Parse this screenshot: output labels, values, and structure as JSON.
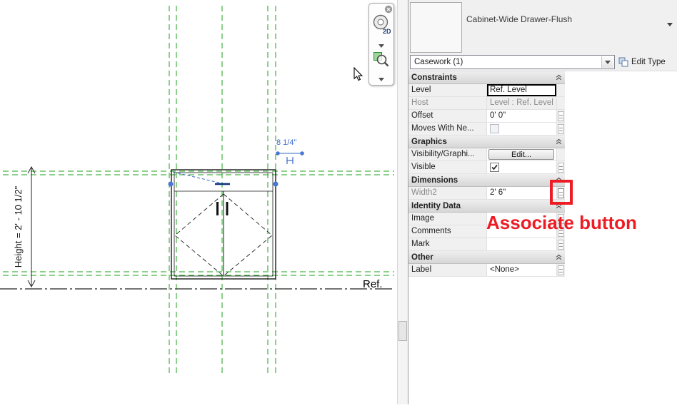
{
  "canvas": {
    "dimension_label": "8 1/4\"",
    "height_label": "Height = 2' - 10 1/2\"",
    "ref_label": "Ref.",
    "navbar_2d": "2D",
    "colors": {
      "reference_plane_green": "#18a018",
      "control_blue": "#3668c8"
    }
  },
  "palette": {
    "type_name": "Cabinet-Wide Drawer-Flush",
    "selector_value": "Casework (1)",
    "edit_type_label": "Edit Type",
    "section_titles": {
      "constraints": "Constraints",
      "graphics": "Graphics",
      "dimensions": "Dimensions",
      "identity": "Identity Data",
      "other": "Other"
    },
    "rows": {
      "level": {
        "label": "Level",
        "value": "Ref. Level"
      },
      "host": {
        "label": "Host",
        "value": "Level : Ref. Level"
      },
      "offset": {
        "label": "Offset",
        "value": "0' 0\""
      },
      "moves": {
        "label": "Moves With Ne...",
        "checked": false
      },
      "visibility": {
        "label": "Visibility/Graphi...",
        "value": "Edit..."
      },
      "visible": {
        "label": "Visible",
        "checked": true
      },
      "width2": {
        "label": "Width2",
        "value": "2' 6\""
      },
      "image": {
        "label": "Image",
        "value": ""
      },
      "comments": {
        "label": "Comments",
        "value": ""
      },
      "mark": {
        "label": "Mark",
        "value": ""
      },
      "label": {
        "label": "Label",
        "value": "<None>"
      }
    }
  },
  "annotation": {
    "text": "Associate button",
    "color": "#ed1c24"
  }
}
